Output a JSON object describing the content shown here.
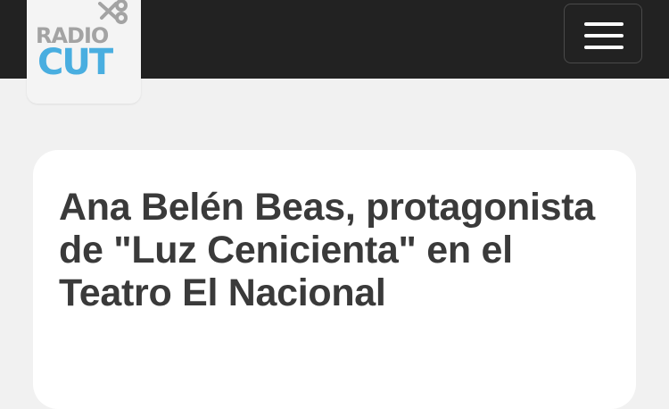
{
  "header": {
    "logo": {
      "line1": "RADIO",
      "line2": "CUT",
      "icon": "scissors-icon",
      "colors": {
        "line1": "#a3a3a3",
        "line2": "#49aee0"
      }
    },
    "menu_icon": "hamburger-menu-icon"
  },
  "article": {
    "title": "Ana Belén Beas, protagonista de \"Luz Cenicienta\" en el Teatro El Nacional"
  },
  "colors": {
    "header_background": "#222222",
    "page_background": "#f1f1f1",
    "card_background": "#ffffff",
    "title_text": "#3a3a3a"
  }
}
